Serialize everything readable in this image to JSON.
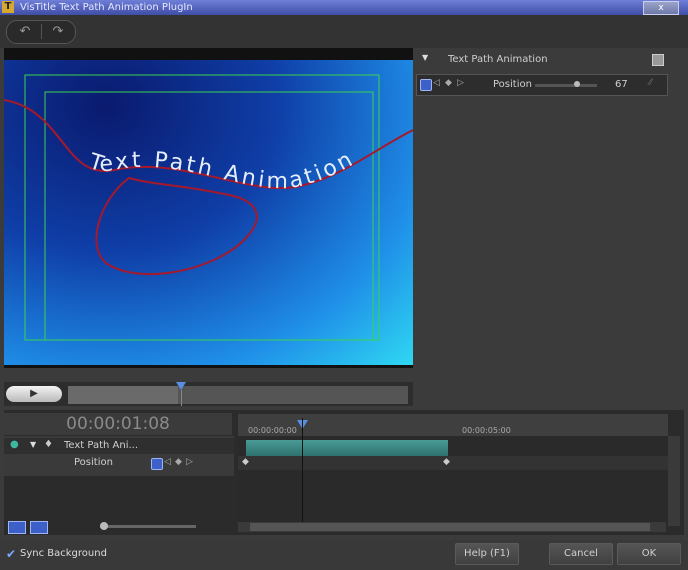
{
  "window": {
    "title": "VisTitle Text Path Animation PlugIn",
    "icon_letter": "T",
    "close_label": "x"
  },
  "toolbar": {
    "undo_icon": "↶",
    "redo_icon": "↷"
  },
  "preview": {
    "text": "Text Path Animation",
    "colors": {
      "path": "#a5192c",
      "safe_area": "#3ad34e",
      "text": "#e6eefc"
    }
  },
  "playback": {
    "play_icon": "▶"
  },
  "properties": {
    "header": "Text Path Animation",
    "expand_icon": "▼",
    "param_label": "Position",
    "param_value": "67",
    "slider_fraction": 0.67
  },
  "timeline": {
    "current_time": "00:00:01:08",
    "ruler_start": "00:00:00:00",
    "ruler_mid": "00:00:05:00",
    "track_label": "Text Path Ani...",
    "sub_label": "Position",
    "clip_color": "#3a8a85"
  },
  "footer": {
    "sync_label": "Sync Background",
    "sync_checked": "✔",
    "help_label": "Help (F1)",
    "cancel_label": "Cancel",
    "ok_label": "OK"
  }
}
